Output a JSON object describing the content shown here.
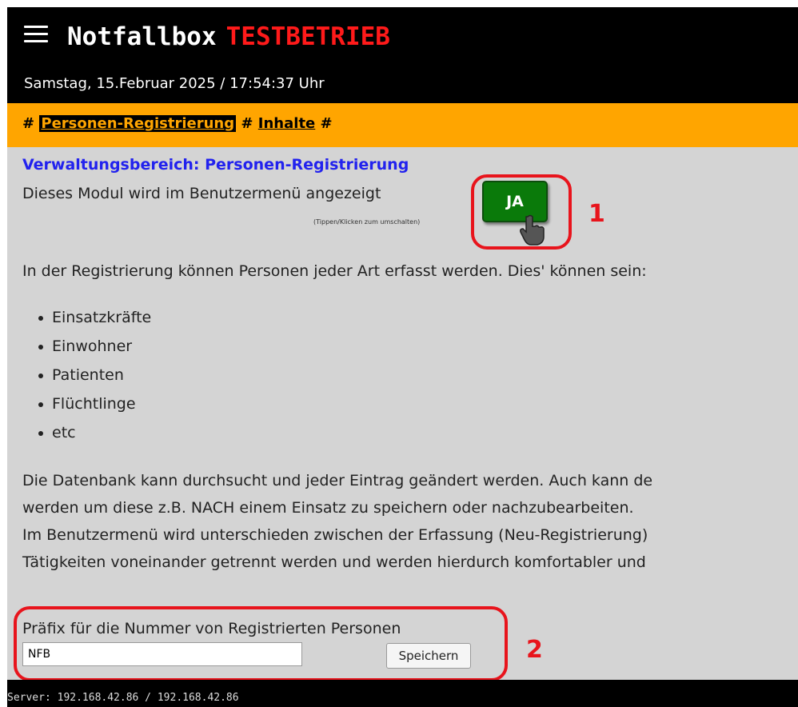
{
  "header": {
    "app_title": "Notfallbox",
    "mode_label": "TESTBETRIEB",
    "datetime": "Samstag, 15.Februar 2025 / 17:54:37 Uhr",
    "menu_icon": "hamburger-menu-icon"
  },
  "nav": {
    "sep": "#",
    "items": [
      {
        "label": "Personen-Registrierung",
        "active": true
      },
      {
        "label": "Inhalte",
        "active": false
      }
    ]
  },
  "main": {
    "heading": "Verwaltungsbereich: Personen-Registrierung",
    "module_text": "Dieses Modul wird im Benutzermenü angezeigt",
    "toggle_label": "JA",
    "toggle_hint": "(Tippen/Klicken zum umschalten)",
    "intro": "In der Registrierung können Personen jeder Art erfasst werden. Dies' können sein:",
    "list": [
      "Einsatzkräfte",
      "Einwohner",
      "Patienten",
      "Flüchtlinge",
      "etc"
    ],
    "paragraph": [
      "Die Datenbank kann durchsucht und jeder Eintrag geändert werden. Auch kann de",
      "werden um diese z.B. NACH einem Einsatz zu speichern oder nachzubearbeiten.",
      "Im Benutzermenü wird unterschieden zwischen der Erfassung (Neu-Registrierung)",
      "Tätigkeiten voneinander getrennt werden und werden hierdurch komfortabler und"
    ],
    "prefix_label": "Präfix für die Nummer von Registrierten Personen",
    "prefix_value": "NFB",
    "save_label": "Speichern"
  },
  "annotations": {
    "callout_1": "1",
    "callout_2": "2",
    "color": "#e8141c"
  },
  "footer": {
    "server": "Server: 192.168.42.86 / 192.168.42.86"
  },
  "colors": {
    "nav_bg": "#ffa500",
    "content_bg": "#d4d4d4",
    "toggle_on": "#0a7a0a",
    "heading": "#2222ee",
    "test_mode": "#ff1a1a"
  }
}
